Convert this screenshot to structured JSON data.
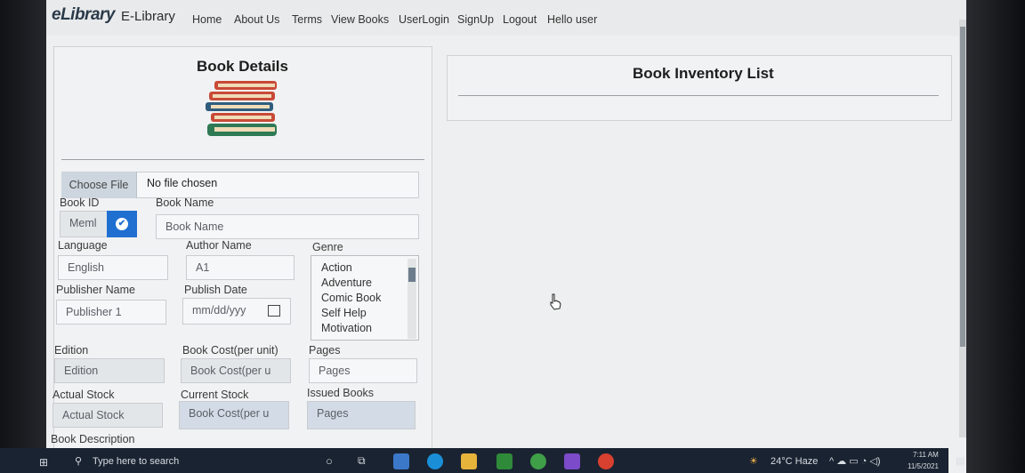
{
  "navbar": {
    "brand_logo": "eLibrary",
    "brand_name": "E-Library",
    "links": [
      "Home",
      "About Us",
      "Terms",
      "View Books",
      "UserLogin",
      "SignUp",
      "Logout",
      "Hello user"
    ]
  },
  "book_details": {
    "title": "Book Details",
    "file_button": "Choose File",
    "file_status": "No file chosen",
    "book_id_label": "Book ID",
    "book_id_value": "Meml",
    "book_name_label": "Book Name",
    "book_name_placeholder": "Book Name",
    "language_label": "Language",
    "language_value": "English",
    "author_label": "Author Name",
    "author_value": "A1",
    "genre_label": "Genre",
    "genres": [
      "Action",
      "Adventure",
      "Comic Book",
      "Self Help",
      "Motivation"
    ],
    "publisher_label": "Publisher Name",
    "publisher_value": "Publisher 1",
    "publish_date_label": "Publish Date",
    "publish_date_placeholder": "mm/dd/yyy",
    "edition_label": "Edition",
    "edition_placeholder": "Edition",
    "cost_label": "Book Cost(per unit)",
    "cost_placeholder": "Book Cost(per u",
    "pages_label": "Pages",
    "pages_placeholder": "Pages",
    "actual_stock_label": "Actual Stock",
    "actual_stock_placeholder": "Actual Stock",
    "current_stock_label": "Current Stock",
    "current_stock_placeholder": "Book Cost(per u",
    "issued_label": "Issued Books",
    "issued_placeholder": "Pages",
    "description_label": "Book Description"
  },
  "inventory": {
    "title": "Book Inventory List"
  },
  "taskbar": {
    "search_placeholder": "Type here to search",
    "weather": "24°C  Haze",
    "time": "7:11 AM",
    "date": "11/5/2021"
  },
  "colors": {
    "accent": "#1f6fd1",
    "taskbar": "#1a2331"
  }
}
